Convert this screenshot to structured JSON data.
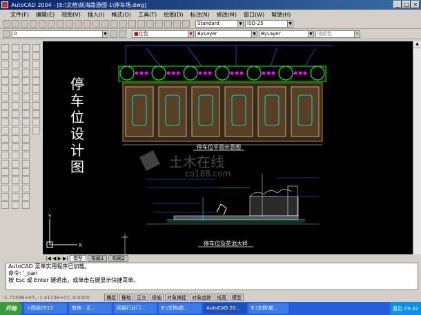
{
  "title": "AutoCAD 2004 - [E:\\文档\\航海路游园-1\\停车场.dwg]",
  "menu": [
    "文件(F)",
    "编辑(E)",
    "视图(V)",
    "插入(I)",
    "格式(O)",
    "工具(T)",
    "绘图(D)",
    "标注(N)",
    "修改(M)",
    "窗口(W)",
    "帮助(H)"
  ],
  "toolbar": {
    "textstyle": "Standard",
    "dimstyle": "ISO-25",
    "layer": "0",
    "color": "■红色",
    "linetype": "ByLayer",
    "lineweight": "ByLayer",
    "plotstyle": "随颜色"
  },
  "drawing": {
    "vertical_title": [
      "停",
      "车",
      "位",
      "设",
      "计",
      "图"
    ],
    "plan_label": "停车位平面示意图",
    "detail_label": "停车位及花池大样",
    "watermark_cn": "土木在线",
    "watermark_url": "co188.com"
  },
  "tabs": [
    "模型",
    "布局1",
    "布局2"
  ],
  "command": [
    "AutoCAD 菜单实用程序已加载。",
    "命令: '_pan",
    "按 Esc 或 Enter 键退出，或单击右键显示快捷菜单。"
  ],
  "status": {
    "coords": "-1.7159E+07, -1.4115E+07, 0.0000",
    "buttons": [
      "捕捉",
      "栅格",
      "正交",
      "极轴",
      "对象捕捉",
      "对象追踪",
      "线宽",
      "模型"
    ]
  },
  "taskbar": {
    "start": "开始",
    "tasks": [
      "+图纸0515",
      "有效 - 正...",
      "网易行业门...",
      "E:\\文档\\航...",
      "AutoCAD 20...",
      "E:\\文档\\航..."
    ],
    "tray": "君见",
    "time": "09:32"
  },
  "colors": {
    "bg": "#000000",
    "green": "#00ff00",
    "magenta": "#ff00ff",
    "cyan": "#00ffff",
    "yellow": "#ffff00",
    "orange": "#d08040"
  }
}
